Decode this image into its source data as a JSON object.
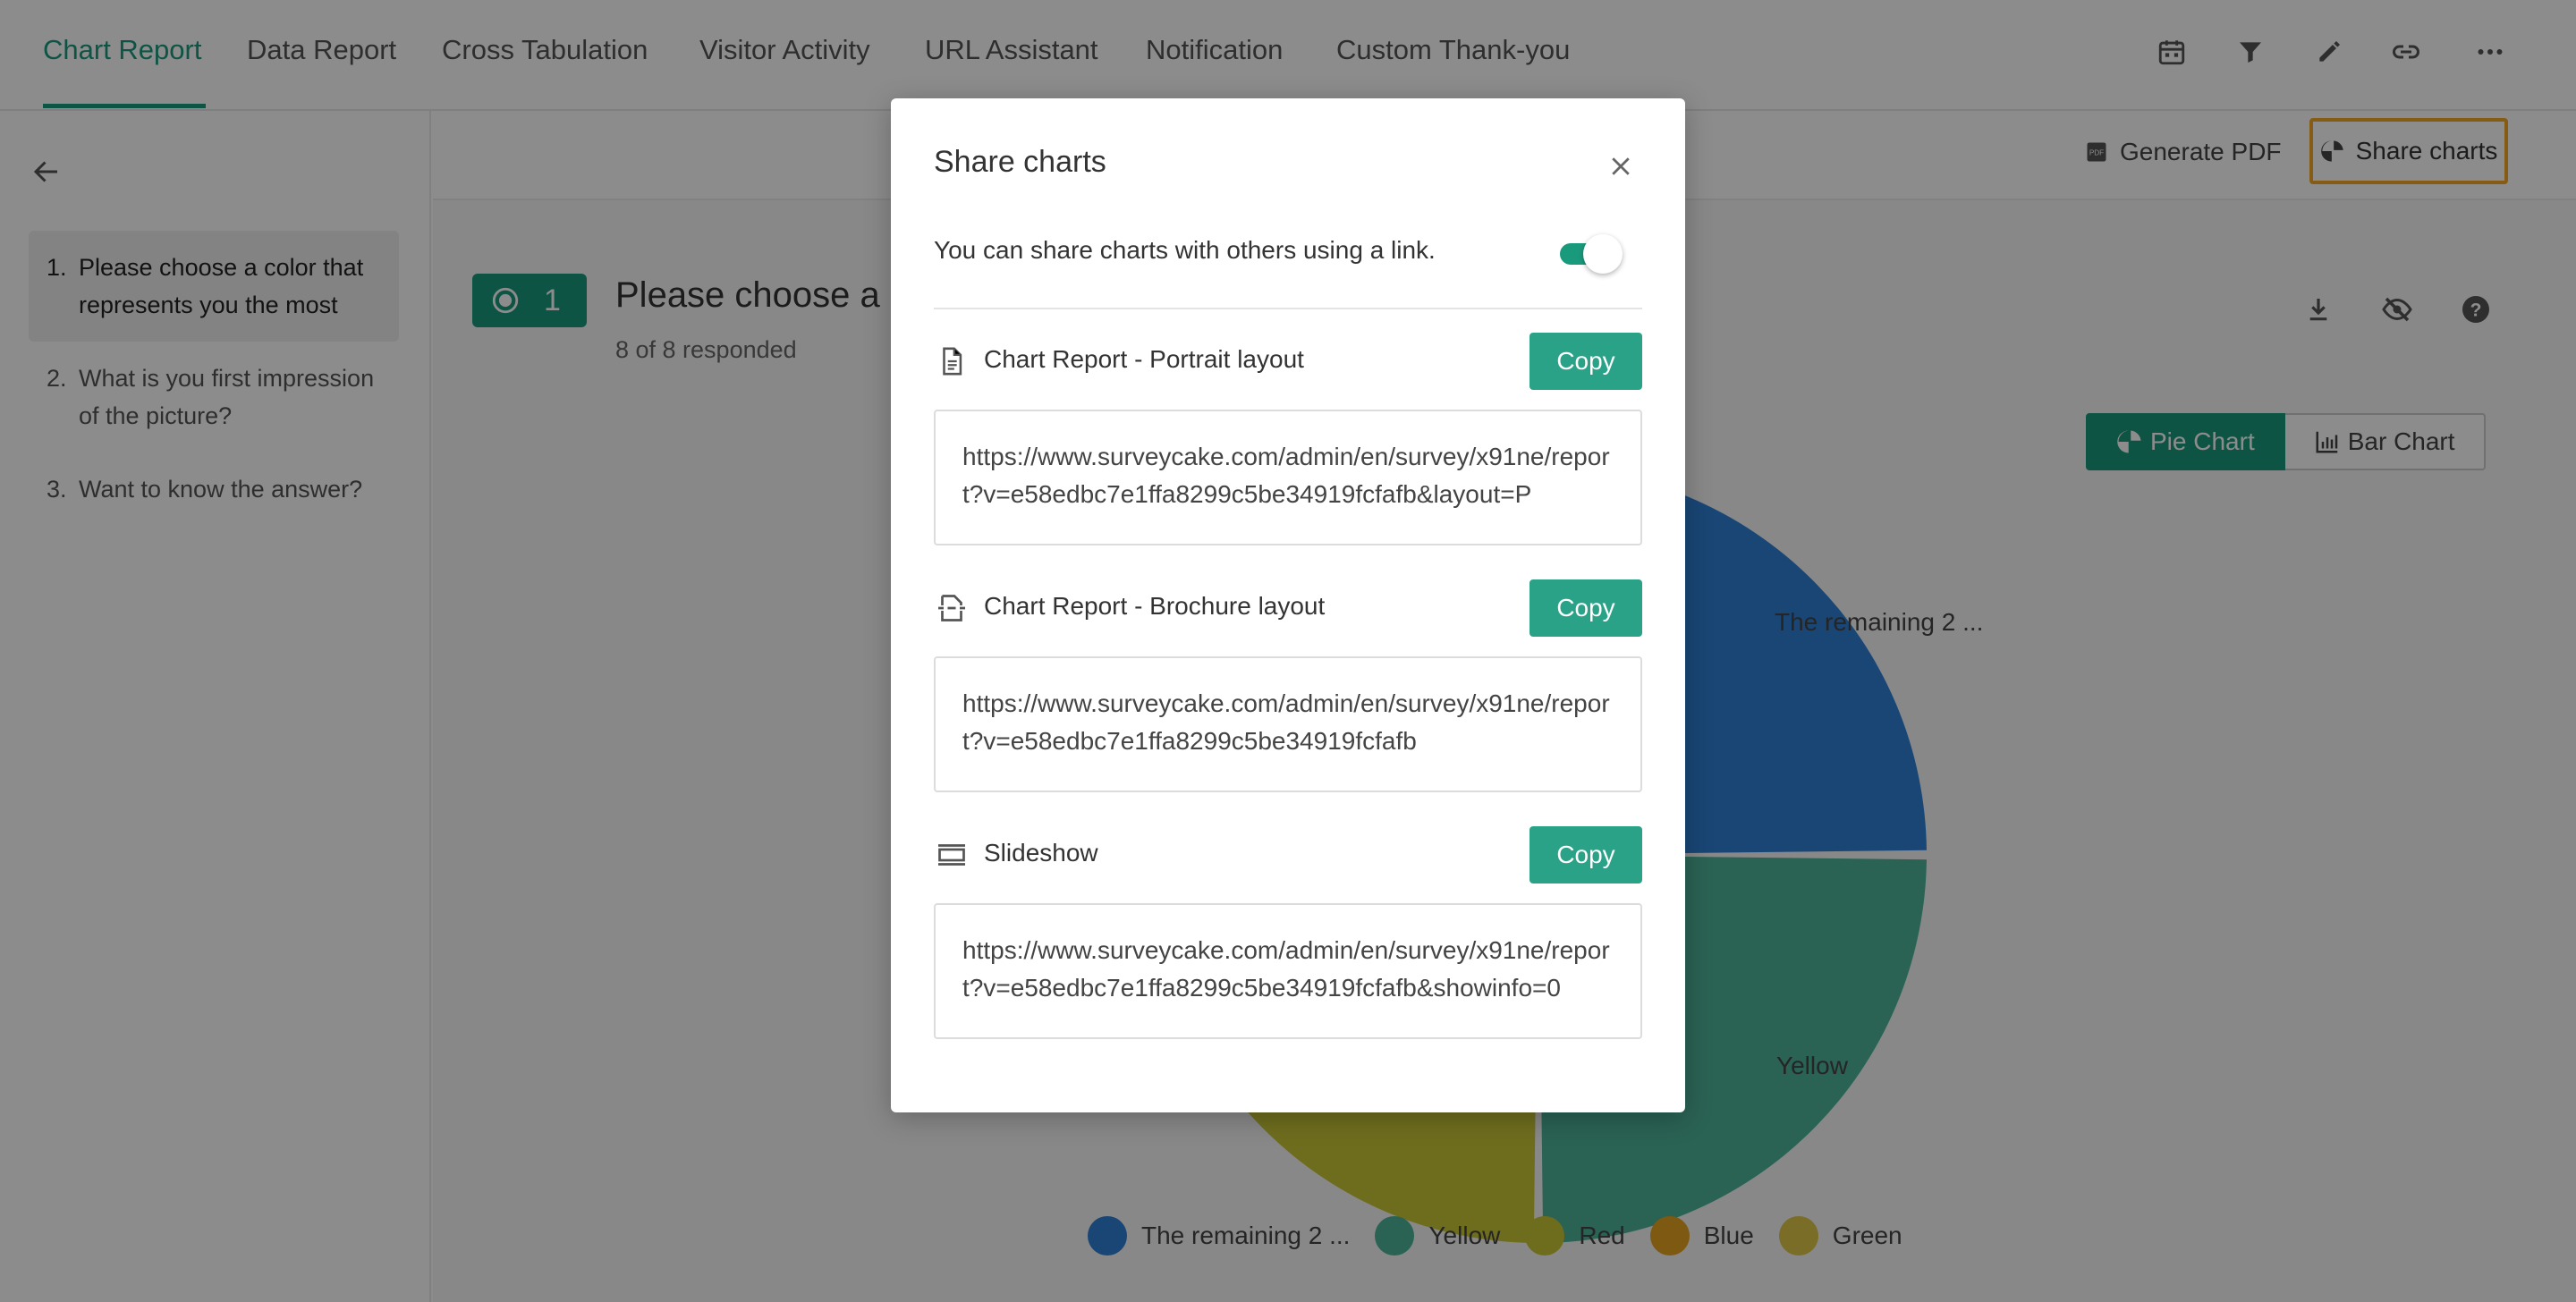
{
  "nav": {
    "tabs": [
      "Chart Report",
      "Data Report",
      "Cross Tabulation",
      "Visitor Activity",
      "URL Assistant",
      "Notification",
      "Custom Thank-you"
    ],
    "active_tab": "Chart Report",
    "icons": [
      "calendar-icon",
      "filter-icon",
      "pencil-icon",
      "link-icon",
      "more-icon"
    ]
  },
  "sidebar": {
    "questions": [
      {
        "num": "1.",
        "label": "Please choose a color that represents you the most"
      },
      {
        "num": "2.",
        "label": "What is you first impression of the picture?"
      },
      {
        "num": "3.",
        "label": "Want to know the answer?"
      }
    ]
  },
  "report_bar": {
    "generate_pdf": "Generate PDF",
    "share_charts": "Share charts"
  },
  "question": {
    "number": "1",
    "title": "Please choose a c",
    "responded": "8 of 8 responded"
  },
  "chart_toggle": {
    "pie": "Pie Chart",
    "bar": "Bar Chart"
  },
  "chart_data": {
    "type": "pie",
    "categories": [
      "The remaining 2 ...",
      "Yellow",
      "Red",
      "Blue",
      "Green"
    ],
    "colors": [
      "#2f80d6",
      "#4db39a",
      "#c8c638",
      "#e6a21f",
      "#ddc64a"
    ],
    "values": [
      2,
      2,
      2,
      1,
      1
    ],
    "visible_labels": [
      "The remaining 2 ...",
      "Yellow"
    ]
  },
  "modal": {
    "title": "Share charts",
    "description": "You can share charts with others using a link.",
    "toggle_on": true,
    "links": [
      {
        "icon": "document-icon",
        "label": "Chart Report - Portrait layout",
        "copy": "Copy",
        "url": "https://www.surveycake.com/admin/en/survey/x91ne/report?v=e58edbc7e1ffa8299c5be34919fcfafb&layout=P"
      },
      {
        "icon": "brochure-icon",
        "label": "Chart Report - Brochure layout",
        "copy": "Copy",
        "url": "https://www.surveycake.com/admin/en/survey/x91ne/report?v=e58edbc7e1ffa8299c5be34919fcfafb"
      },
      {
        "icon": "slideshow-icon",
        "label": "Slideshow",
        "copy": "Copy",
        "url": "https://www.surveycake.com/admin/en/survey/x91ne/report?v=e58edbc7e1ffa8299c5be34919fcfafb&showinfo=0"
      }
    ]
  }
}
